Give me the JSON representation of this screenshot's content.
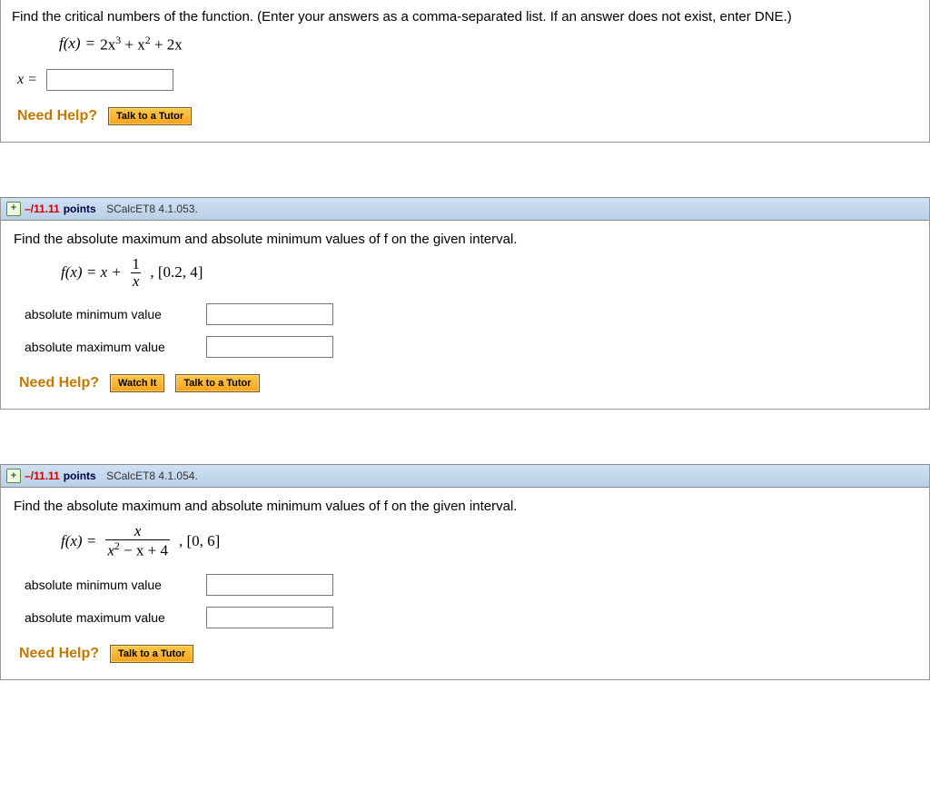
{
  "q1": {
    "prompt": "Find the critical numbers of the function. (Enter your answers as a comma-separated list. If an answer does not exist, enter DNE.)",
    "formula_fx": "f(x)",
    "formula_eq": "=",
    "formula_rhs_a": "2x",
    "formula_rhs_b": "3",
    "formula_rhs_c": " + x",
    "formula_rhs_d": "2",
    "formula_rhs_e": " + 2x",
    "x_label": "x =",
    "need_help": "Need Help?",
    "tutor_btn": "Talk to a Tutor"
  },
  "q2": {
    "points_neg": "–/11.11",
    "points_label": " points",
    "ref": "SCalcET8 4.1.053.",
    "prompt": "Find the absolute maximum and absolute minimum values of f on the given interval.",
    "fx": "f(x) = x + ",
    "frac_num": "1",
    "frac_den": "x",
    "interval": ",  [0.2, 4]",
    "min_label": "absolute minimum value",
    "max_label": "absolute maximum value",
    "need_help": "Need Help?",
    "watch_btn": "Watch It",
    "tutor_btn": "Talk to a Tutor"
  },
  "q3": {
    "points_neg": "–/11.11",
    "points_label": " points",
    "ref": "SCalcET8 4.1.054.",
    "prompt": "Find the absolute maximum and absolute minimum values of f on the given interval.",
    "fx_lhs": "f(x) = ",
    "frac_num": "x",
    "frac_den_a": "x",
    "frac_den_b": "2",
    "frac_den_c": " − x + 4",
    "interval": ",  [0, 6]",
    "min_label": "absolute minimum value",
    "max_label": "absolute maximum value",
    "need_help": "Need Help?",
    "tutor_btn": "Talk to a Tutor"
  }
}
